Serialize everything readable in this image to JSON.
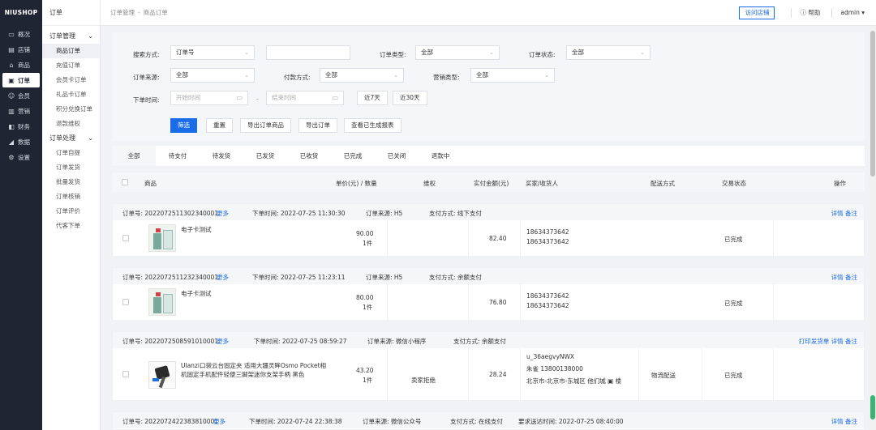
{
  "brand": "NIUSHOP",
  "nav": [
    {
      "icon": "▭",
      "icon_name": "overview-icon",
      "label": "概况"
    },
    {
      "icon": "▤",
      "icon_name": "store-icon",
      "label": "店铺"
    },
    {
      "icon": "⌂",
      "icon_name": "goods-icon",
      "label": "商品"
    },
    {
      "icon": "▣",
      "icon_name": "order-icon",
      "label": "订单"
    },
    {
      "icon": "☺",
      "icon_name": "member-icon",
      "label": "会员"
    },
    {
      "icon": "▥",
      "icon_name": "marketing-icon",
      "label": "营销"
    },
    {
      "icon": "◧",
      "icon_name": "finance-icon",
      "label": "财务"
    },
    {
      "icon": "◢",
      "icon_name": "data-icon",
      "label": "数据"
    },
    {
      "icon": "⚙",
      "icon_name": "settings-icon",
      "label": "设置"
    }
  ],
  "submenu": {
    "title": "订单",
    "group1": "订单管理",
    "items1": [
      "商品订单",
      "充值订单",
      "会员卡订单",
      "礼品卡订单",
      "积分兑换订单",
      "退款维权"
    ],
    "group2": "订单处理",
    "items2": [
      "订单自提",
      "订单发货",
      "批量发货",
      "订单核销",
      "订单评价",
      "代客下单"
    ]
  },
  "topbar": {
    "crumb1": "订单管理",
    "crumb_sep": "-",
    "crumb2": "商品订单",
    "visit": "访问店铺",
    "help": "帮助",
    "admin": "admin"
  },
  "filters": {
    "search_label": "搜索方式:",
    "search_value": "订单号",
    "order_type_label": "订单类型:",
    "order_type_value": "全部",
    "order_status_label": "订单状态:",
    "order_status_value": "全部",
    "source_label": "订单来源:",
    "source_value": "全部",
    "pay_label": "付款方式:",
    "pay_value": "全部",
    "marketing_label": "营销类型:",
    "marketing_value": "全部",
    "time_label": "下单时间:",
    "start_ph": "开始时间",
    "dash": "-",
    "end_ph": "结束时间",
    "last7": "近7天",
    "last30": "近30天",
    "filter_btn": "筛选",
    "reset_btn": "重置",
    "export_goods_btn": "导出订单商品",
    "export_order_btn": "导出订单",
    "report_btn": "查看已生成报表"
  },
  "tabs": [
    "全部",
    "待支付",
    "待发货",
    "已发货",
    "已收货",
    "已完成",
    "已关闭",
    "退款中"
  ],
  "table_headers": {
    "goods": "商品",
    "price_qty": "单价(元) / 数量",
    "rights": "维权",
    "paid": "实付金额(元)",
    "buyer": "买家/收货人",
    "delivery": "配送方式",
    "status": "交易状态",
    "ops": "操作"
  },
  "orders": [
    {
      "no": "订单号: 2022072511302340001",
      "more": "更多",
      "time": "下单时间: 2022-07-25 11:30:30",
      "source": "订单来源: H5",
      "pay": "支付方式: 线下支付",
      "ops": "详情 备注",
      "goods_name": "电子卡测试",
      "price": "90.00",
      "qty": "1件",
      "rights": "",
      "paid": "82.40",
      "buyer_link": "18634373642",
      "buyer_line2": "18634373642",
      "buyer_line3": "",
      "delivery": "",
      "status": "已完成"
    },
    {
      "no": "订单号: 2022072511232340001",
      "more": "更多",
      "time": "下单时间: 2022-07-25 11:23:11",
      "source": "订单来源: H5",
      "pay": "支付方式: 余额支付",
      "ops": "详情 备注",
      "goods_name": "电子卡测试",
      "price": "80.00",
      "qty": "1件",
      "rights": "",
      "paid": "76.80",
      "buyer_link": "18634373642",
      "buyer_line2": "18634373642",
      "buyer_line3": "",
      "delivery": "",
      "status": "已完成"
    },
    {
      "no": "订单号: 2022072508591010001",
      "more": "更多",
      "time": "下单时间: 2022-07-25 08:59:27",
      "source": "订单来源: 微信小程序",
      "pay": "支付方式: 余额支付",
      "ops": "打印发货单 详情 备注",
      "goods_name": "Ulanzi口袋云台固定夹 适用大疆灵眸Osmo Pocket相机固定手机配件轻便三脚架迷你支架手柄 黑色",
      "price": "43.20",
      "qty": "1件",
      "rights": "卖家拒绝",
      "paid": "28.24",
      "buyer_link": "u_36aegvyNWX",
      "buyer_line2": "朱雀  13800138000",
      "buyer_line3": "北京市-北京市-东城区 他们城 ▣ 楼",
      "delivery": "物流配送",
      "status": "已完成"
    },
    {
      "no": "订单号: 2022072422383810001",
      "more": "更多",
      "time": "下单时间: 2022-07-24 22:38:38",
      "source": "订单来源: 微信公众号",
      "pay": "支付方式: 在线支付",
      "extra": "要求送达时间: 2022-07-25 08:40:00",
      "ops": "详情 备注"
    }
  ]
}
